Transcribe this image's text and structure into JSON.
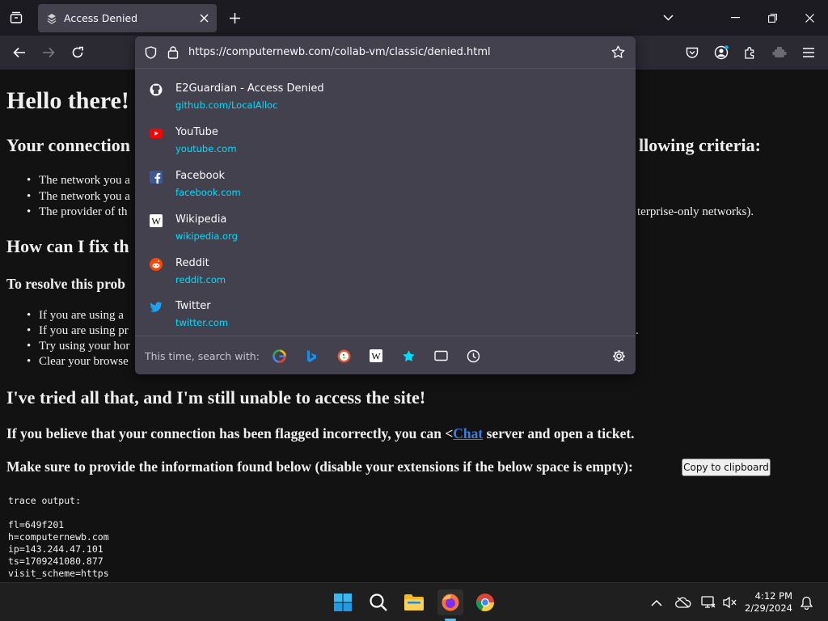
{
  "browser": {
    "tab": {
      "title": "Access Denied"
    },
    "url": "https://computernewb.com/collab-vm/classic/denied.html"
  },
  "suggestions": [
    {
      "title": "E2Guardian - Access Denied",
      "url": "github.com/LocalAlloc",
      "icon": "github-icon"
    },
    {
      "title": "YouTube",
      "url": "youtube.com",
      "icon": "youtube-icon"
    },
    {
      "title": "Facebook",
      "url": "facebook.com",
      "icon": "facebook-icon"
    },
    {
      "title": "Wikipedia",
      "url": "wikipedia.org",
      "icon": "wikipedia-icon"
    },
    {
      "title": "Reddit",
      "url": "reddit.com",
      "icon": "reddit-icon"
    },
    {
      "title": "Twitter",
      "url": "twitter.com",
      "icon": "twitter-icon"
    }
  ],
  "search_with": {
    "label": "This time, search with:",
    "engines": [
      "google-icon",
      "bing-icon",
      "duckduckgo-icon",
      "wikipedia-icon",
      "bookmarks-icon",
      "tabs-icon",
      "history-icon"
    ]
  },
  "page": {
    "heading": "Hello there!",
    "conn_heading_left": "Your connection",
    "conn_heading_right": "llowing criteria:",
    "bullets1": [
      "The network you a",
      "The network you a",
      "The provider of th"
    ],
    "bullet3_tail": "terprise-only networks).",
    "fix_heading": "How can I fix th",
    "resolve_text": "To resolve this prob",
    "bullets2": [
      "If you are using a ",
      "If you are using pr",
      "Try using your hor",
      "Clear your browse"
    ],
    "bullets2_tail": ".",
    "tried_heading": "I've tried all that, and I'm still unable to access the site!",
    "flagged_before": "If you believe that your connection has been flagged incorrectly, you can <",
    "flagged_link": "Chat",
    "flagged_after": " server and open a ticket.",
    "provide_text": "Make sure to provide the information found below (disable your extensions if the below space is empty):",
    "copy_button": "Copy to clipboard",
    "trace_label": "trace output:",
    "trace_lines": [
      "fl=649f201",
      "h=computernewb.com",
      "ip=143.244.47.101",
      "ts=1709241080.877",
      "visit_scheme=https"
    ]
  },
  "taskbar": {
    "time": "4:12 PM",
    "date": "2/29/2024"
  }
}
